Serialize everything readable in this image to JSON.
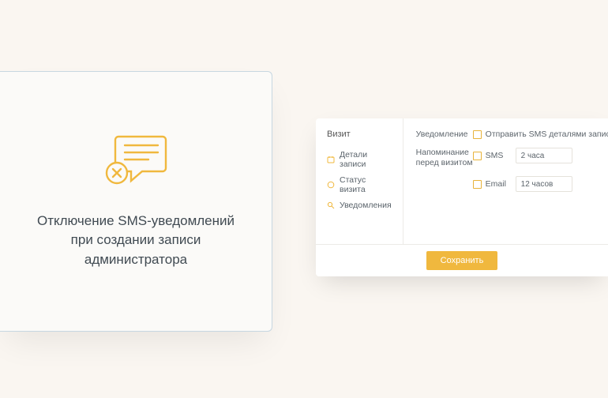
{
  "leftCard": {
    "title": "Отключение SMS-уведомлений при создании записи администратора"
  },
  "panel": {
    "sidebar": {
      "title": "Визит",
      "items": [
        {
          "label": "Детали записи"
        },
        {
          "label": "Статус визита"
        },
        {
          "label": "Уведомления"
        }
      ]
    },
    "main": {
      "notificationLabel": "Уведомление",
      "sendSmsDetails": "Отправить SMS деталями записи",
      "reminderLabel": "Напоминание перед визитом",
      "smsLabel": "SMS",
      "smsValue": "2 часа",
      "emailLabel": "Email",
      "emailValue": "12 часов"
    },
    "footer": {
      "saveLabel": "Сохранить"
    }
  }
}
